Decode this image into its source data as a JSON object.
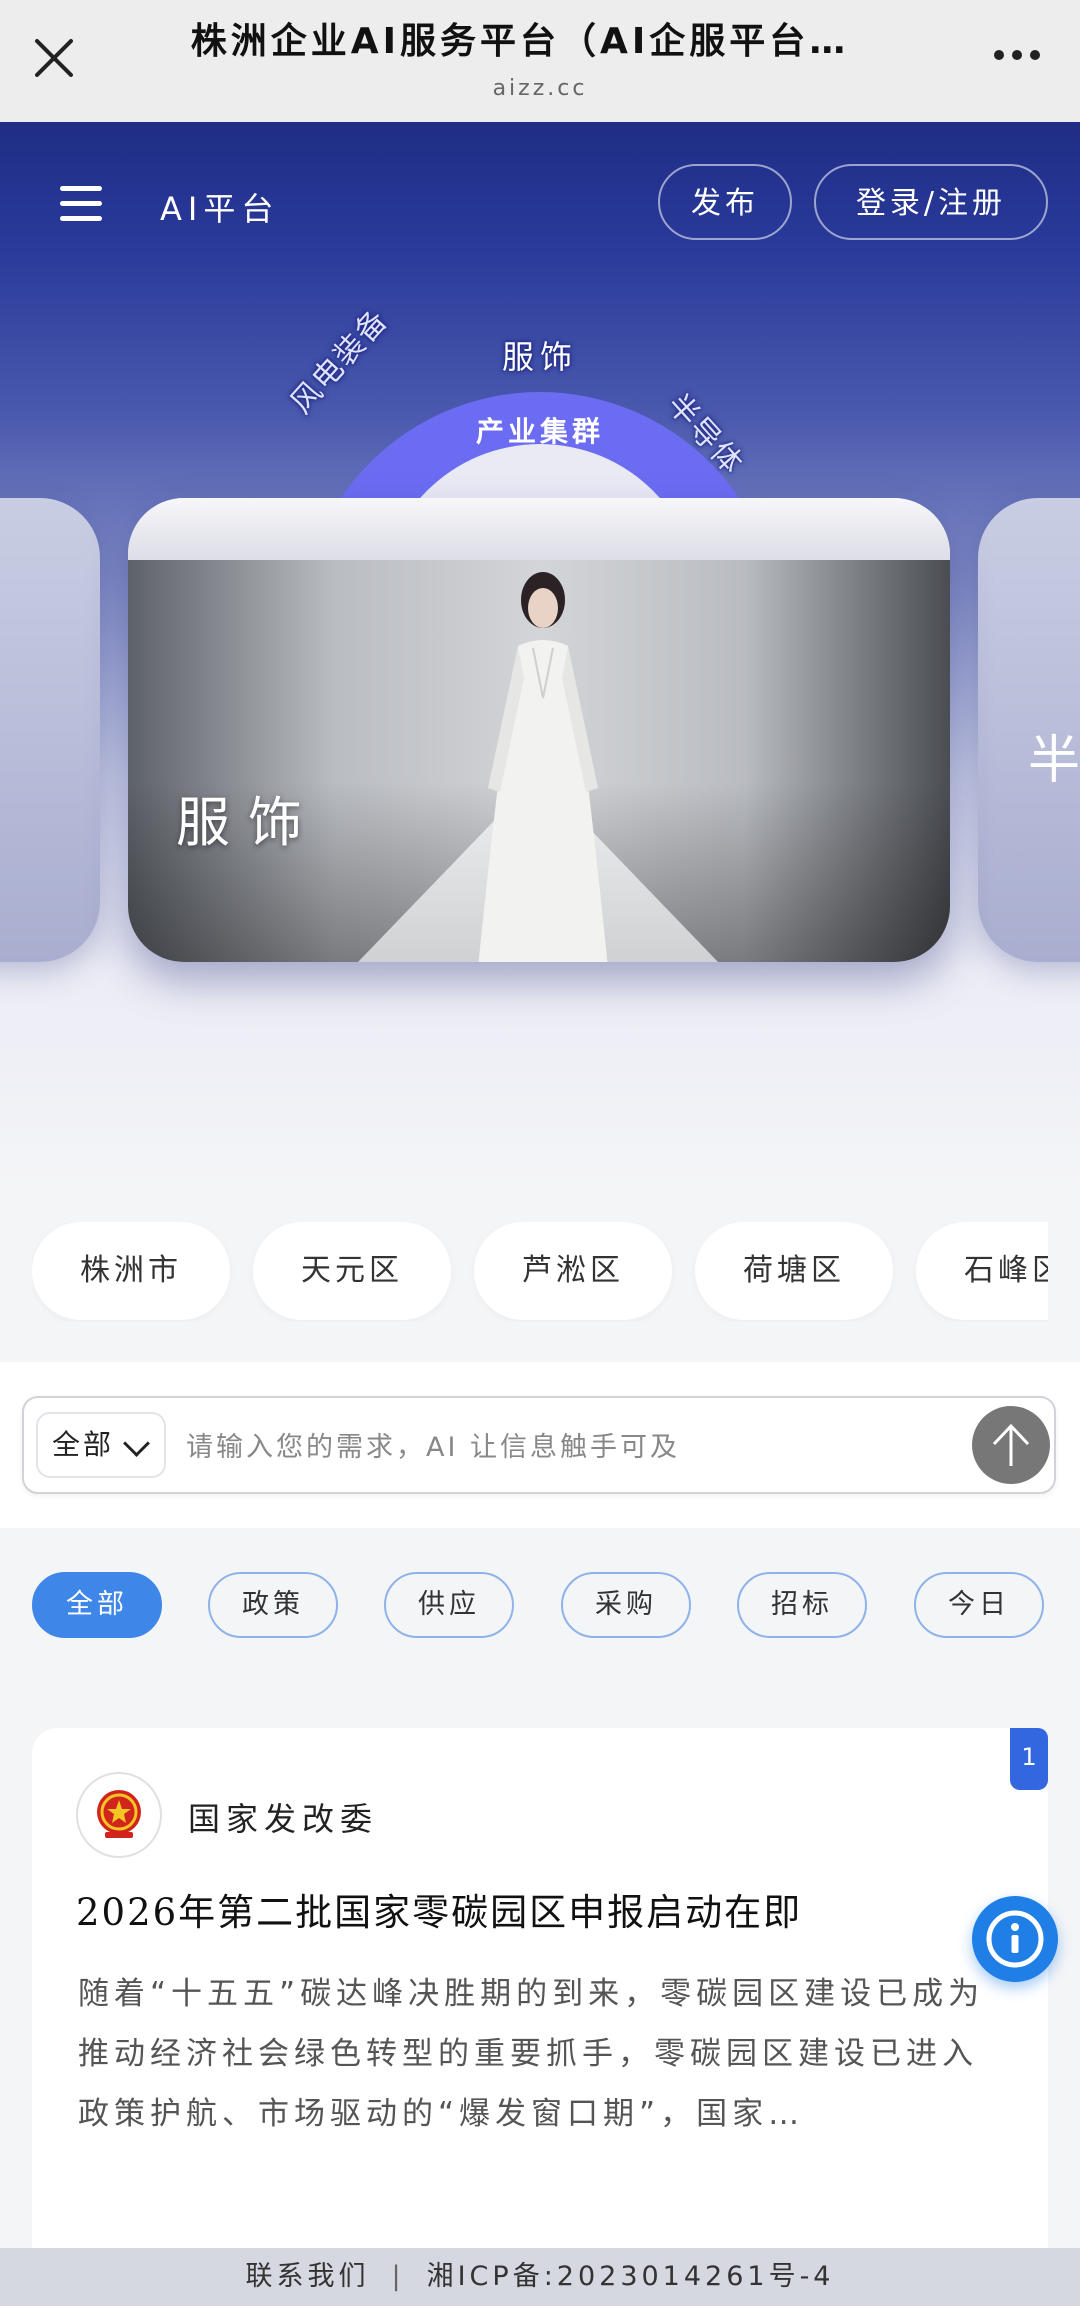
{
  "browser": {
    "title": "株洲企业AI服务平台（AI企服平台…",
    "url": "aizz.cc",
    "close_icon": "close-icon",
    "more_icon": "more-dots-icon"
  },
  "header": {
    "brand": "AI平台",
    "publish_label": "发布",
    "login_label": "登录/注册"
  },
  "hero": {
    "arc_top": "服饰",
    "arc_center": "产业集群",
    "arc_left": "风电装备",
    "arc_right": "半导体",
    "card_label": "服饰",
    "next_card_label": "半"
  },
  "districts": [
    "株洲市",
    "天元区",
    "芦淞区",
    "荷塘区",
    "石峰区"
  ],
  "search": {
    "scope": "全部",
    "placeholder": "请输入您的需求，AI 让信息触手可及"
  },
  "filters": [
    {
      "label": "全部",
      "active": true
    },
    {
      "label": "政策",
      "active": false
    },
    {
      "label": "供应",
      "active": false
    },
    {
      "label": "采购",
      "active": false
    },
    {
      "label": "招标",
      "active": false
    },
    {
      "label": "今日",
      "active": false
    }
  ],
  "news": {
    "rank": "1",
    "org": "国家发改委",
    "title": "2026年第二批国家零碳园区申报启动在即",
    "summary": "随着“十五五”碳达峰决胜期的到来，零碳园区建设已成为推动经济社会绿色转型的重要抓手，零碳园区建设已进入政策护航、市场驱动的“爆发窗口期”，国家…"
  },
  "footer": {
    "contact": "联系我们",
    "separator": "|",
    "icp": "湘ICP备:2023014261号-4"
  },
  "colors": {
    "accent": "#3e86e8",
    "hero_top": "#1f2d86",
    "arc": "#6b6cf2",
    "badge": "#3367e0"
  }
}
